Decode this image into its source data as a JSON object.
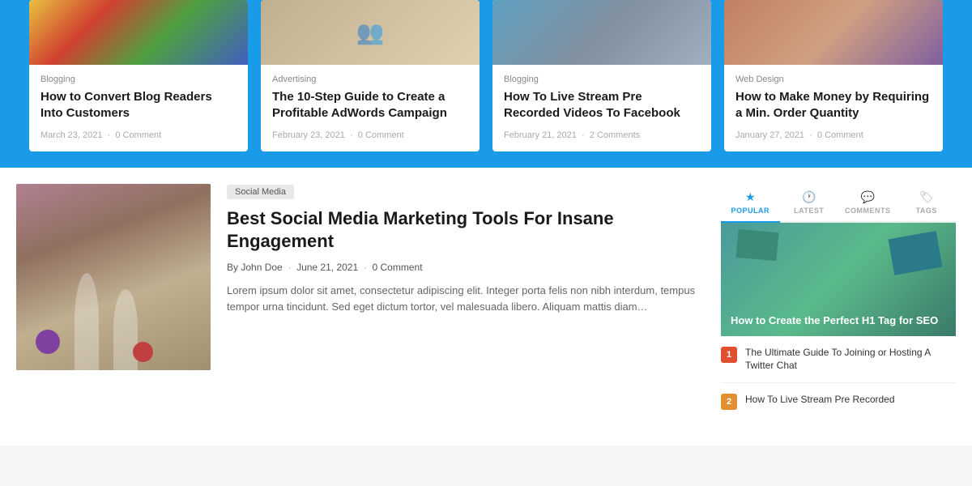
{
  "top": {
    "cards": [
      {
        "id": "card-1",
        "category": "Blogging",
        "title": "How to Convert Blog Readers Into Customers",
        "date": "March 23, 2021",
        "comments": "0 Comment",
        "img_class": "card-img-1"
      },
      {
        "id": "card-2",
        "category": "Advertising",
        "title": "The 10-Step Guide to Create a Profitable AdWords Campaign",
        "date": "February 23, 2021",
        "comments": "0 Comment",
        "img_class": "card-img-2"
      },
      {
        "id": "card-3",
        "category": "Blogging",
        "title": "How To Live Stream Pre Recorded Videos To Facebook",
        "date": "February 21, 2021",
        "comments": "2 Comments",
        "img_class": "card-img-3"
      },
      {
        "id": "card-4",
        "category": "Web Design",
        "title": "How to Make Money by Requiring a Min. Order Quantity",
        "date": "January 27, 2021",
        "comments": "0 Comment",
        "img_class": "card-img-4"
      }
    ]
  },
  "bottom": {
    "article": {
      "tag": "Social Media",
      "title": "Best Social Media Marketing Tools For Insane Engagement",
      "author": "John Doe",
      "date": "June 21, 2021",
      "comments": "0 Comment",
      "by_label": "By",
      "excerpt": "Lorem ipsum dolor sit amet, consectetur adipiscing elit. Integer porta felis non nibh interdum, tempus tempor urna tincidunt. Sed eget dictum tortor, vel malesuada libero. Aliquam mattis diam…"
    },
    "sidebar": {
      "tabs": [
        {
          "id": "popular",
          "label": "POPULAR",
          "icon": "★",
          "active": true
        },
        {
          "id": "latest",
          "label": "LATEST",
          "icon": "🕐",
          "active": false
        },
        {
          "id": "comments",
          "label": "COMMENTS",
          "icon": "💬",
          "active": false
        },
        {
          "id": "tags",
          "label": "TAGS",
          "icon": "🏷",
          "active": false
        }
      ],
      "featured": {
        "title": "How to Create the Perfect H1 Tag for SEO"
      },
      "list": [
        {
          "num": "1",
          "color": "#e05030",
          "title": "The Ultimate Guide To Joining or Hosting A Twitter Chat"
        },
        {
          "num": "2",
          "color": "#e09030",
          "title": "How To Live Stream Pre Recorded"
        }
      ]
    }
  }
}
